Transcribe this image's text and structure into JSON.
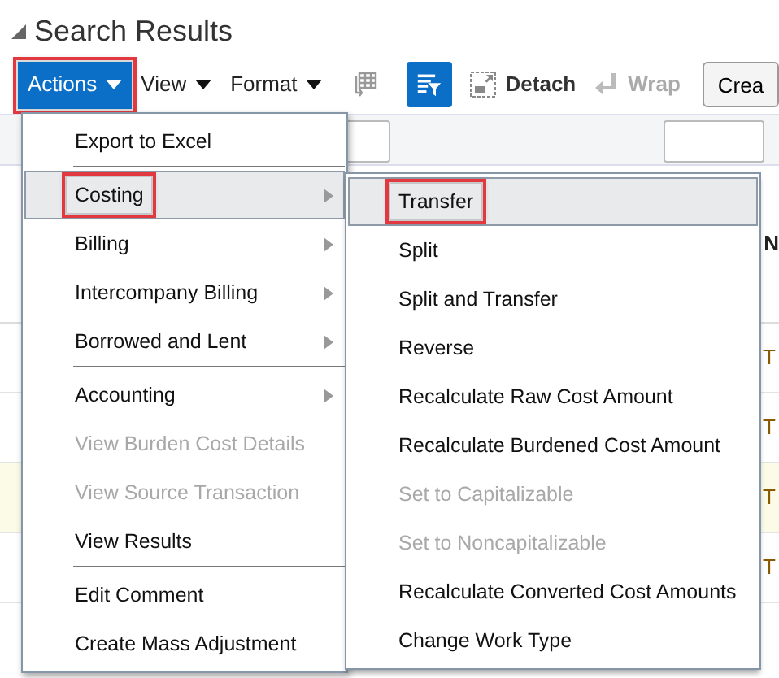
{
  "title": "Search Results",
  "toolbar": {
    "menus": [
      {
        "label": "Actions",
        "open": true,
        "callout": true
      },
      {
        "label": "View",
        "open": false,
        "callout": false
      },
      {
        "label": "Format",
        "open": false,
        "callout": false
      }
    ],
    "query_by_example": {
      "on": true
    },
    "detach": {
      "label": "Detach",
      "disabled": false
    },
    "wrap": {
      "label": "Wrap",
      "disabled": true
    },
    "create_button": {
      "label": "Crea"
    }
  },
  "table": {
    "column_header": "N",
    "rows": [
      {
        "cell": "T",
        "selected": false
      },
      {
        "cell": "T",
        "selected": false
      },
      {
        "cell": "T",
        "selected": true
      },
      {
        "cell": "T",
        "selected": false
      }
    ]
  },
  "actions_menu": [
    {
      "label": "Export to Excel",
      "kind": "action",
      "disabled": false,
      "selected": false,
      "callout": false,
      "divider_before": false
    },
    {
      "label": "Costing",
      "kind": "submenu",
      "disabled": false,
      "selected": true,
      "callout": true,
      "divider_before": true
    },
    {
      "label": "Billing",
      "kind": "submenu",
      "disabled": false,
      "selected": false,
      "callout": false,
      "divider_before": false
    },
    {
      "label": "Intercompany Billing",
      "kind": "submenu",
      "disabled": false,
      "selected": false,
      "callout": false,
      "divider_before": false
    },
    {
      "label": "Borrowed and Lent",
      "kind": "submenu",
      "disabled": false,
      "selected": false,
      "callout": false,
      "divider_before": false
    },
    {
      "label": "Accounting",
      "kind": "submenu",
      "disabled": false,
      "selected": false,
      "callout": false,
      "divider_before": true
    },
    {
      "label": "View Burden Cost Details",
      "kind": "action",
      "disabled": true,
      "selected": false,
      "callout": false,
      "divider_before": false
    },
    {
      "label": "View Source Transaction",
      "kind": "action",
      "disabled": true,
      "selected": false,
      "callout": false,
      "divider_before": false
    },
    {
      "label": "View Results",
      "kind": "action",
      "disabled": false,
      "selected": false,
      "callout": false,
      "divider_before": false
    },
    {
      "label": "Edit Comment",
      "kind": "action",
      "disabled": false,
      "selected": false,
      "callout": false,
      "divider_before": true
    },
    {
      "label": "Create Mass Adjustment",
      "kind": "action",
      "disabled": false,
      "selected": false,
      "callout": false,
      "divider_before": false
    }
  ],
  "costing_submenu": [
    {
      "label": "Transfer",
      "kind": "action",
      "disabled": false,
      "selected": true,
      "callout": true,
      "divider_before": false
    },
    {
      "label": "Split",
      "kind": "action",
      "disabled": false,
      "selected": false,
      "callout": false,
      "divider_before": false
    },
    {
      "label": "Split and Transfer",
      "kind": "action",
      "disabled": false,
      "selected": false,
      "callout": false,
      "divider_before": false
    },
    {
      "label": "Reverse",
      "kind": "action",
      "disabled": false,
      "selected": false,
      "callout": false,
      "divider_before": false
    },
    {
      "label": "Recalculate Raw Cost Amount",
      "kind": "action",
      "disabled": false,
      "selected": false,
      "callout": false,
      "divider_before": false
    },
    {
      "label": "Recalculate Burdened Cost Amount",
      "kind": "action",
      "disabled": false,
      "selected": false,
      "callout": false,
      "divider_before": false
    },
    {
      "label": "Set to Capitalizable",
      "kind": "action",
      "disabled": true,
      "selected": false,
      "callout": false,
      "divider_before": false
    },
    {
      "label": "Set to Noncapitalizable",
      "kind": "action",
      "disabled": true,
      "selected": false,
      "callout": false,
      "divider_before": false
    },
    {
      "label": "Recalculate Converted Cost Amounts",
      "kind": "action",
      "disabled": false,
      "selected": false,
      "callout": false,
      "divider_before": false
    },
    {
      "label": "Change Work Type",
      "kind": "action",
      "disabled": false,
      "selected": false,
      "callout": false,
      "divider_before": false
    }
  ]
}
